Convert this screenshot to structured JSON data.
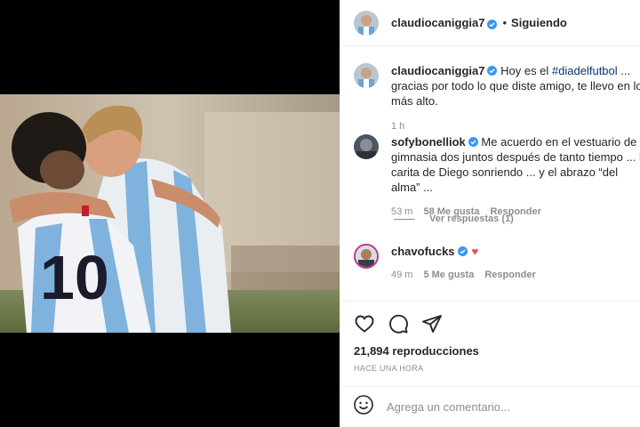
{
  "header": {
    "username": "claudiocaniggia7",
    "separator": "•",
    "follow_status": "Siguiendo"
  },
  "caption": {
    "username": "claudiocaniggia7",
    "text_before": "Hoy es el ",
    "hashtag": "#diadelfutbol",
    "text_after": " ... gracias por todo lo que diste amigo, te llevo en lo más alto.",
    "time": "1 h"
  },
  "comments": [
    {
      "username": "sofybonelliok",
      "text": "Me acuerdo en el vestuario de gimnasia dos juntos después de tanto tiempo ... la carita de Diego sonriendo ... y el abrazo “del alma” ...",
      "time": "53 m",
      "likes": "58 Me gusta",
      "reply": "Responder",
      "view_replies": "Ver respuestas (1)"
    },
    {
      "username": "chavofucks",
      "text": "♥",
      "time": "49 m",
      "likes": "5 Me gusta",
      "reply": "Responder"
    }
  ],
  "stats": {
    "views": "21,894 reproducciones",
    "posted": "HACE UNA HORA"
  },
  "add_comment": {
    "placeholder": "Agrega un comentario..."
  },
  "icons": {
    "like": "heart-icon",
    "comment": "comment-icon",
    "share": "share-icon",
    "emoji": "emoji-icon",
    "verified": "verified-badge-icon"
  },
  "colors": {
    "verified_blue": "#3897f0",
    "heart_red": "#ed4956",
    "hashtag": "#00376b",
    "secondary_text": "#8e8e8e"
  }
}
